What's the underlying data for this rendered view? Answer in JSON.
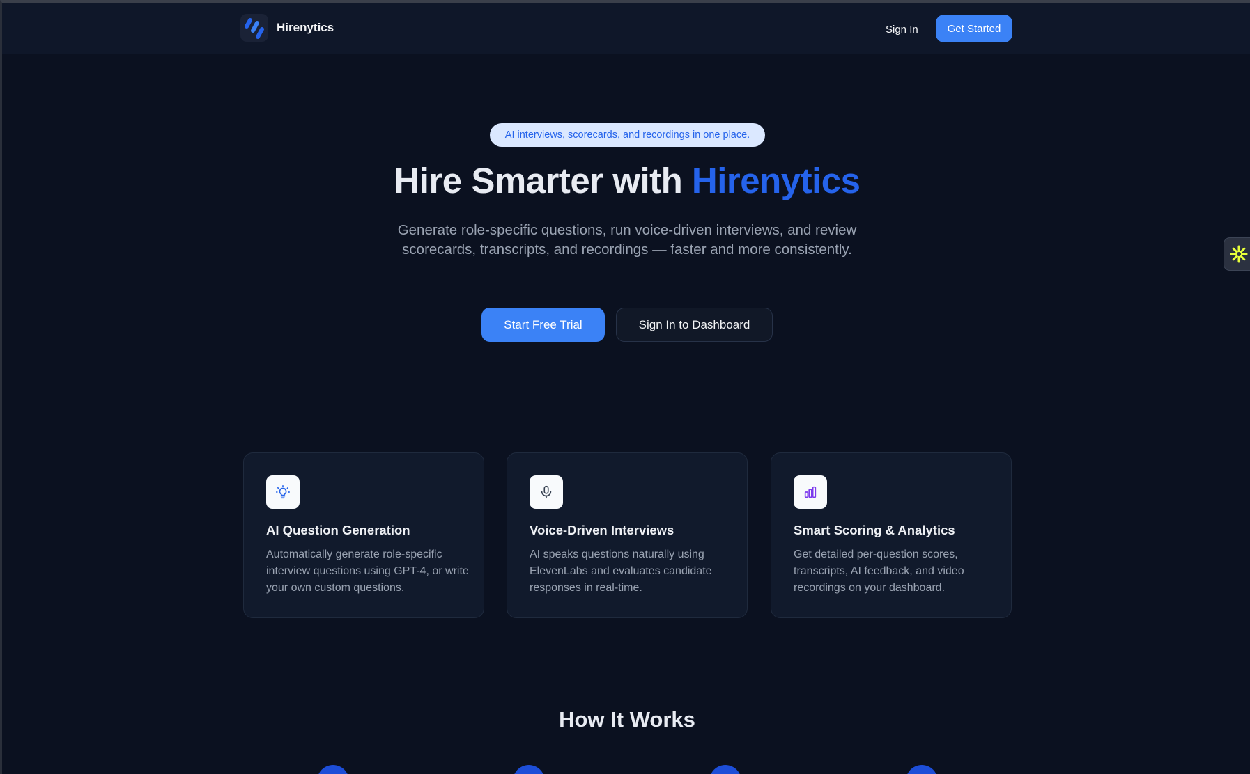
{
  "header": {
    "brand_name": "Hirenytics",
    "sign_in_label": "Sign In",
    "get_started_label": "Get Started"
  },
  "hero": {
    "pill_text": "AI interviews, scorecards, and recordings in one place.",
    "title_prefix": "Hire Smarter with ",
    "title_accent": "Hirenytics",
    "subtitle": "Generate role-specific questions, run voice-driven interviews, and review scorecards, transcripts, and recordings — faster and more consistently.",
    "primary_cta": "Start Free Trial",
    "secondary_cta": "Sign In to Dashboard"
  },
  "features": [
    {
      "icon": "lightbulb-icon",
      "title": "AI Question Generation",
      "description": "Automatically generate role-specific interview questions using GPT-4, or write your own custom questions."
    },
    {
      "icon": "microphone-icon",
      "title": "Voice-Driven Interviews",
      "description": "AI speaks questions naturally using ElevenLabs and evaluates candidate responses in real-time."
    },
    {
      "icon": "bar-chart-icon",
      "title": "Smart Scoring & Analytics",
      "description": "Get detailed per-question scores, transcripts, AI feedback, and video recordings on your dashboard."
    }
  ],
  "how_it_works": {
    "title": "How It Works"
  },
  "colors": {
    "background": "#0b1120",
    "accent": "#3b82f6",
    "accent_text": "#2563eb",
    "card_bg": "#111a2c"
  }
}
